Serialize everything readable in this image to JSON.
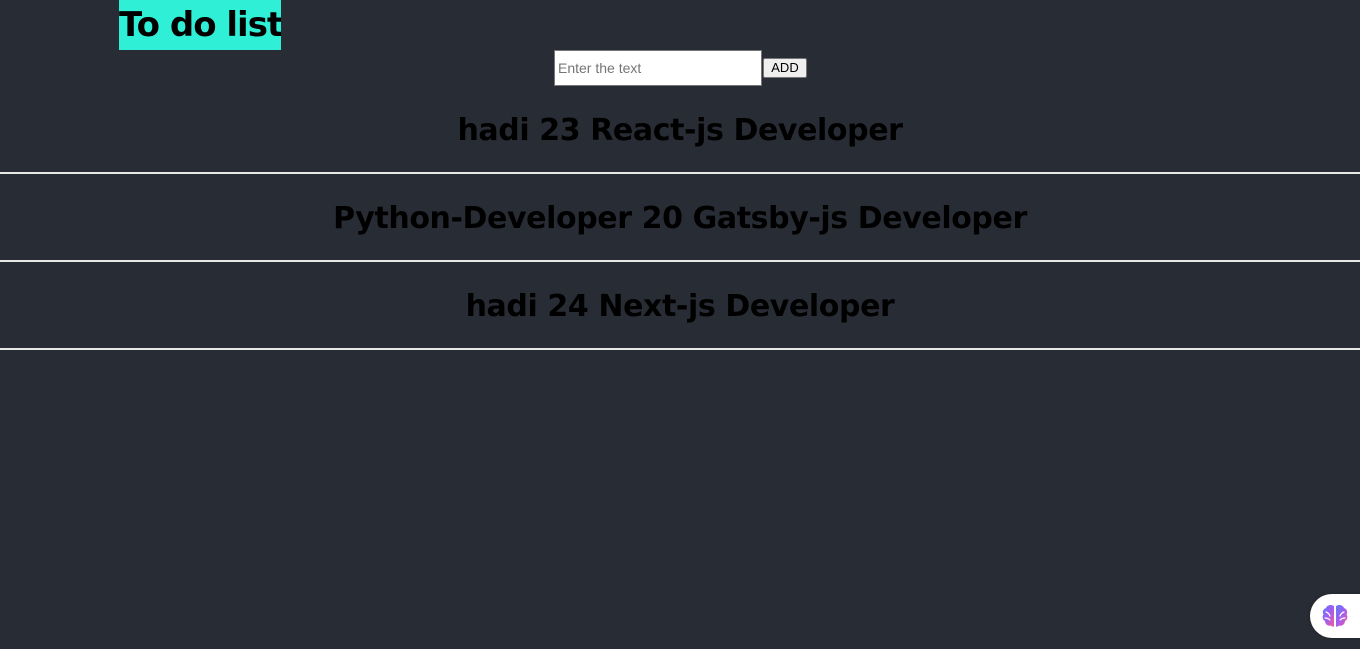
{
  "header": {
    "title": "To do list"
  },
  "entry": {
    "placeholder": "Enter the text",
    "value": "",
    "add_label": "ADD"
  },
  "todos": [
    {
      "text": "hadi 23 React-js Developer"
    },
    {
      "text": "Python-Developer 20 Gatsby-js Developer"
    },
    {
      "text": "hadi 24 Next-js Developer"
    }
  ],
  "extension": {
    "icon": "brain-icon"
  },
  "colors": {
    "background": "#282c34",
    "title_highlight": "#2ff0d6",
    "divider": "#e8e8e8"
  }
}
